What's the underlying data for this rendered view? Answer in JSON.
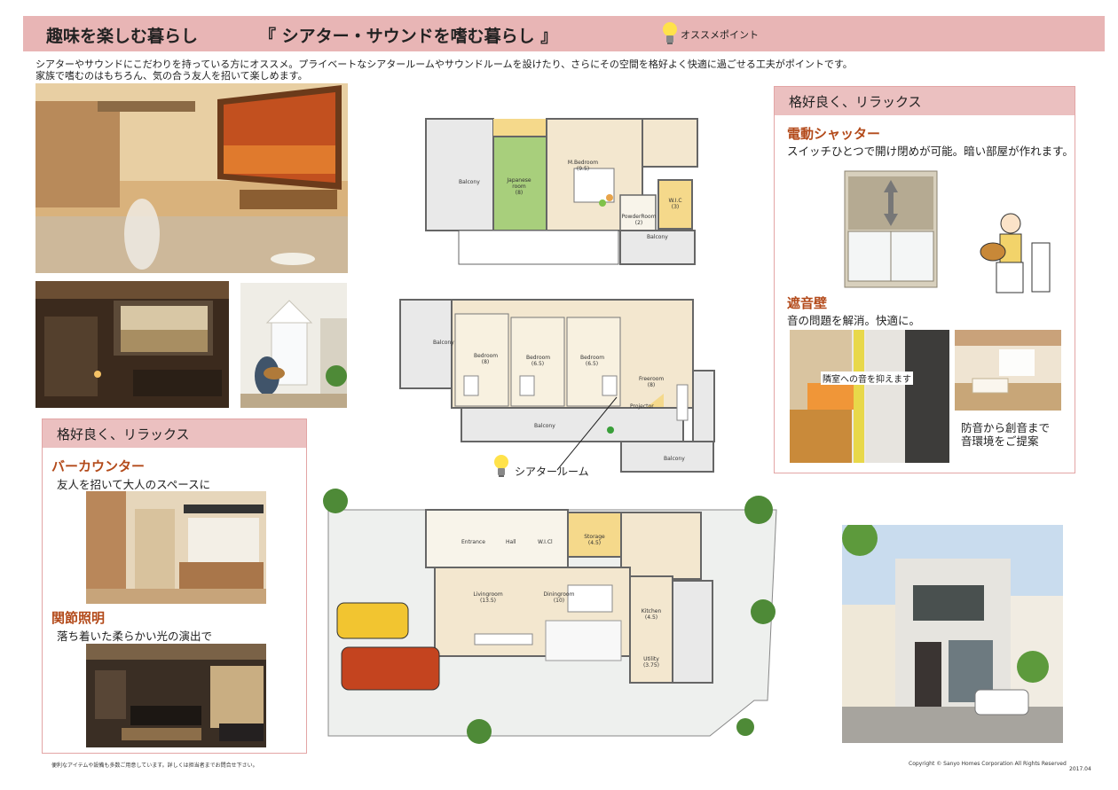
{
  "header": {
    "title_left": "趣味を楽しむ暮らし",
    "title_main": "『 シアター・サウンドを嗜む暮らし 』",
    "point_label": "オススメポイント"
  },
  "intro": {
    "line1": "シアターやサウンドにこだわりを持っている方にオススメ。プライベートなシアタールームやサウンドルームを設けたり、さらにその空間を格好よく快適に過ごせる工夫がポイントです。",
    "line2": "家族で嗜むのはもちろん、気の合う友人を招いて楽しめます。"
  },
  "floor3": {
    "balcony_left": "Balcony",
    "japanese": "Japanese room",
    "japanese_size": "(8)",
    "mbed": "M.Bedroom",
    "mbed_size": "(9.5)",
    "powder": "PowderRoom",
    "powder_size": "(2)",
    "wic": "W.I.C",
    "wic_size": "(3)",
    "balcony_right": "Balcony"
  },
  "floor2": {
    "balcony_left": "Balcony",
    "bed1": "Bedroom",
    "bed1_size": "(8)",
    "bed2": "Bedroom",
    "bed2_size": "(6.5)",
    "bed3": "Bedroom",
    "bed3_size": "(6.5)",
    "free": "Freeroom",
    "free_size": "(8)",
    "projector": "Projector",
    "balcony_bottom": "Balcony",
    "balcony_br": "Balcony",
    "theater_label": "シアタールーム"
  },
  "floor1": {
    "entrance": "Entrance",
    "hall": "Hall",
    "wicl": "W.I.Cl",
    "storage": "Storage",
    "storage_size": "(4.5)",
    "living": "Livingroom",
    "living_size": "(13.5)",
    "dining": "Diningroom",
    "dining_size": "(10)",
    "kitchen": "Kitchen",
    "kitchen_size": "(4.5)",
    "utility": "Utility",
    "utility_size": "(3.75)"
  },
  "panel_right": {
    "title": "格好良く、リラックス",
    "shutter_title": "電動シャッター",
    "shutter_desc": "スイッチひとつで開け閉めが可能。暗い部屋が作れます。",
    "wall_title": "遮音壁",
    "wall_desc": "音の問題を解消。快適に。",
    "wall_label": "隣室への音を抑えます",
    "caption_line1": "防音から創音まで",
    "caption_line2": "音環境をご提案"
  },
  "panel_left": {
    "title": "格好良く、リラックス",
    "bar_title": "バーカウンター",
    "bar_desc": "友人を招いて大人のスペースに",
    "light_title": "関節照明",
    "light_desc": "落ち着いた柔らかい光の演出で"
  },
  "footer": {
    "left": "便利なアイテムや設備も多数ご用意しています。詳しくは担当者までお問合せ下さい。",
    "copyright": "Copyright ©  Sanyo Homes Corporation All Rights Reserved",
    "date": "2017.04"
  },
  "colors": {
    "header_bg": "#e8b5b5",
    "panel_border": "#e3a5a5",
    "accent_brown": "#b34a1a",
    "tatami_green": "#a8cf7c",
    "storage_yellow": "#f5d98b"
  }
}
